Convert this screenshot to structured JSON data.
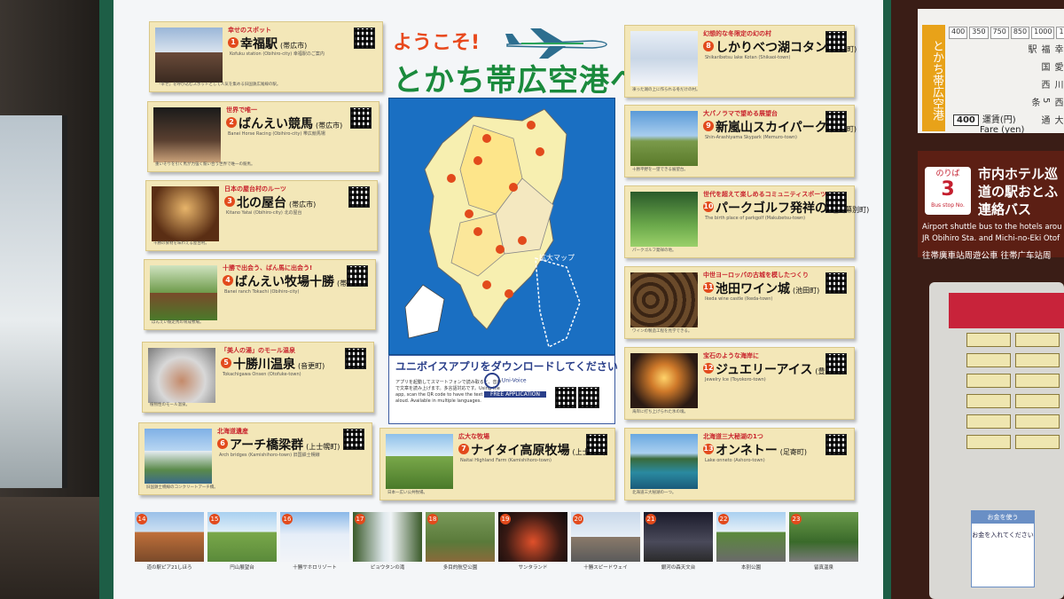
{
  "header": {
    "line1": "ようこそ!",
    "line2": "とかち帯広空港へ"
  },
  "map": {
    "label": "拡大マップ"
  },
  "app_banner": {
    "title": "ユニボイスアプリをダウンロードしてください",
    "text": "アプリを起動してスマートフォンで読み取ると、音声で文章を読み上げます。多言語対応です。Using the app, scan the QR code to have the text read aloud. Available in multiple languages.",
    "logo": "Uni-Voice",
    "free": "FREE APPLICATION"
  },
  "cards_left": [
    {
      "num": "1",
      "cap": "幸せのスポット",
      "title": "幸福駅",
      "town": "(帯広市)",
      "sub": "Kofuku station (Obihiro-city) 幸福駅のご案内",
      "text": "「幸せ」を呼び込むスポットとして人気を集める旧国鉄広尾線の駅。"
    },
    {
      "num": "2",
      "cap": "世界で唯一",
      "title": "ばんえい競馬",
      "town": "(帯広市)",
      "sub": "Banei Horse Racing (Obihiro-city) 帯広競馬場",
      "text": "重いそりを引く馬が力強く競い合う世界で唯一の競馬。"
    },
    {
      "num": "3",
      "cap": "日本の屋台村のルーツ",
      "title": "北の屋台",
      "town": "(帯広市)",
      "sub": "Kitano Yatai (Obihiro-city) 北の屋台",
      "text": "十勝の食材を味わえる屋台村。"
    },
    {
      "num": "4",
      "cap": "十勝で出会う、ばん馬に出会う!",
      "title": "ばんえい牧場十勝",
      "town": "(帯広市)",
      "sub": "Banei ranch Tokachi (Obihiro-city)",
      "text": "ばんえい競走馬の育成牧場。"
    },
    {
      "num": "5",
      "cap": "「美人の湯」のモール温泉",
      "title": "十勝川温泉",
      "town": "(音更町)",
      "sub": "Tokachigawa Onsen (Otofuke-town)",
      "text": "植物性のモール温泉。"
    },
    {
      "num": "6",
      "cap": "北海道遺産",
      "title": "アーチ橋梁群",
      "town": "(上士幌町)",
      "sub": "Arch bridges (Kamishihoro-town) 旧国鉄士幌線",
      "text": "旧国鉄士幌線のコンクリートアーチ橋。"
    }
  ],
  "card_center": {
    "num": "7",
    "cap": "広大な牧場",
    "title": "ナイタイ高原牧場",
    "town": "(上士幌町)",
    "sub": "Naitai Highland Farm (Kamishihoro-town)",
    "text": "日本一広い公共牧場。"
  },
  "cards_right": [
    {
      "num": "8",
      "cap": "幻想的な冬限定の幻の村",
      "title": "しかりべつ湖コタン",
      "town": "(鹿追町)",
      "sub": "Shikaribetsu lake Kotan (Shikaoi-town)",
      "text": "凍った湖の上に作られる冬だけの村。"
    },
    {
      "num": "9",
      "cap": "大パノラマで望める展望台",
      "title": "新嵐山スカイパーク",
      "town": "(芽室町)",
      "sub": "Shin-Arashiyama Skypark (Memuro-town)",
      "text": "十勝平野を一望できる展望台。"
    },
    {
      "num": "10",
      "cap": "世代を超えて楽しめるコミュニティスポーツ",
      "title": "パークゴルフ発祥の地",
      "town": "(幕別町)",
      "sub": "The birth place of parkgolf (Makubetsu-town)",
      "text": "パークゴルフ発祥の地。"
    },
    {
      "num": "11",
      "cap": "中世ヨーロッパの古城を模したつくり",
      "title": "池田ワイン城",
      "town": "(池田町)",
      "sub": "Ikeda wine castle (Ikeda-town)",
      "text": "ワインの製造工程を見学できる。"
    },
    {
      "num": "12",
      "cap": "宝石のような海岸に",
      "title": "ジュエリーアイス",
      "town": "(豊頃町)",
      "sub": "Jewelry Ice (Toyokoro-town)",
      "text": "海岸に打ち上げられた氷の塊。"
    },
    {
      "num": "13",
      "cap": "北海道三大秘湖の1つ",
      "title": "オンネトー",
      "town": "(足寄町)",
      "sub": "Lake onneto (Ashoro-town)",
      "text": "北海道三大秘湖の一つ。"
    }
  ],
  "bottom": [
    {
      "n": "14",
      "label": "道の駅ピア21しほろ"
    },
    {
      "n": "15",
      "label": "円山展望台"
    },
    {
      "n": "16",
      "label": "十勝サホロリゾート"
    },
    {
      "n": "17",
      "label": "ピョウタンの滝"
    },
    {
      "n": "18",
      "label": "多目的航空公園"
    },
    {
      "n": "19",
      "label": "サンタランド"
    },
    {
      "n": "20",
      "label": "十勝スピードウェイ"
    },
    {
      "n": "21",
      "label": "銀河の森天文台"
    },
    {
      "n": "22",
      "label": "本別公園"
    },
    {
      "n": "23",
      "label": "留真温泉"
    }
  ],
  "bus": {
    "stop_label": "のりば",
    "stop_en": "Bus stop No.",
    "stop_no": "3",
    "title": "市内ホテル巡 道の駅おとふ 連絡バス",
    "en": "Airport shuttle bus to the hotels arou JR Obihiro Sta. and Michi-no-Eki Otof",
    "jp2": "往帯廣車站周遊公車 往帯广车站周"
  },
  "fare": {
    "route": "とかち帯広空港",
    "strip": [
      "400",
      "350",
      "750",
      "850",
      "1000",
      "1000",
      "1200"
    ],
    "stops": [
      "幸福駅",
      "愛国",
      "川西",
      "西5条",
      "大通"
    ],
    "amount": "400",
    "jp": "運賃(円)",
    "en": "Fare (yen)"
  },
  "machine_card": {
    "title": "お金を使う",
    "body": "お金を入れてください"
  },
  "colors": {
    "accent_orange": "#e8491d",
    "accent_green": "#1a8a3c",
    "card_bg": "#f3e7b8",
    "map_blue": "#1a6fc2"
  }
}
